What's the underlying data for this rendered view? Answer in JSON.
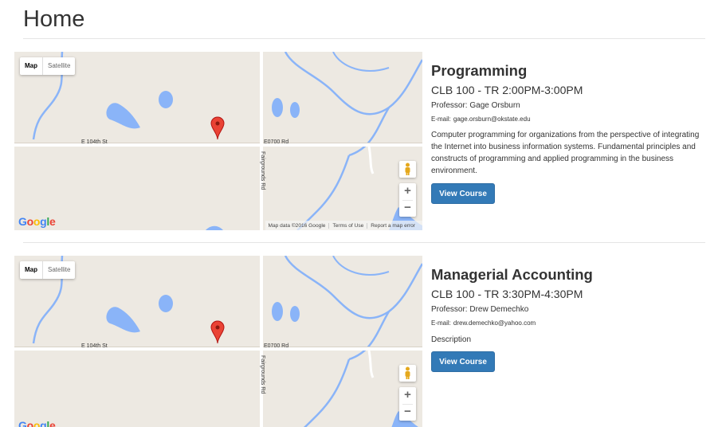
{
  "page": {
    "title": "Home"
  },
  "map_common": {
    "type_map": "Map",
    "type_satellite": "Satellite",
    "road_e104": "E 104th St",
    "road_e0700": "E0700 Rd",
    "road_fairgrounds": "Fairgrounds Rd",
    "zoom_in": "+",
    "zoom_out": "−",
    "google_logo": "Google",
    "attribution": [
      "Map data ©2016 Google",
      "Terms of Use",
      "Report a map error"
    ],
    "colors": {
      "land": "#ede9e2",
      "water": "#8ab4f8",
      "road": "#ffffff",
      "marker": "#ea4335"
    }
  },
  "courses": [
    {
      "name": "Programming",
      "location": "CLB 100 - TR 2:00PM-3:00PM",
      "professor": "Professor: Gage Orsburn",
      "email_label": "E-mail:",
      "email": "gage.orsburn@okstate.edu",
      "description": "Computer programming for organizations from the perspective of integrating the Internet into business information systems. Fundamental principles and constructs of programming and applied programming in the business environment.",
      "button": "View Course"
    },
    {
      "name": "Managerial Accounting",
      "location": "CLB 100 - TR 3:30PM-4:30PM",
      "professor": "Professor: Drew Demechko",
      "email_label": "E-mail:",
      "email": "drew.demechko@yahoo.com",
      "description": "Description",
      "button": "View Course"
    }
  ]
}
